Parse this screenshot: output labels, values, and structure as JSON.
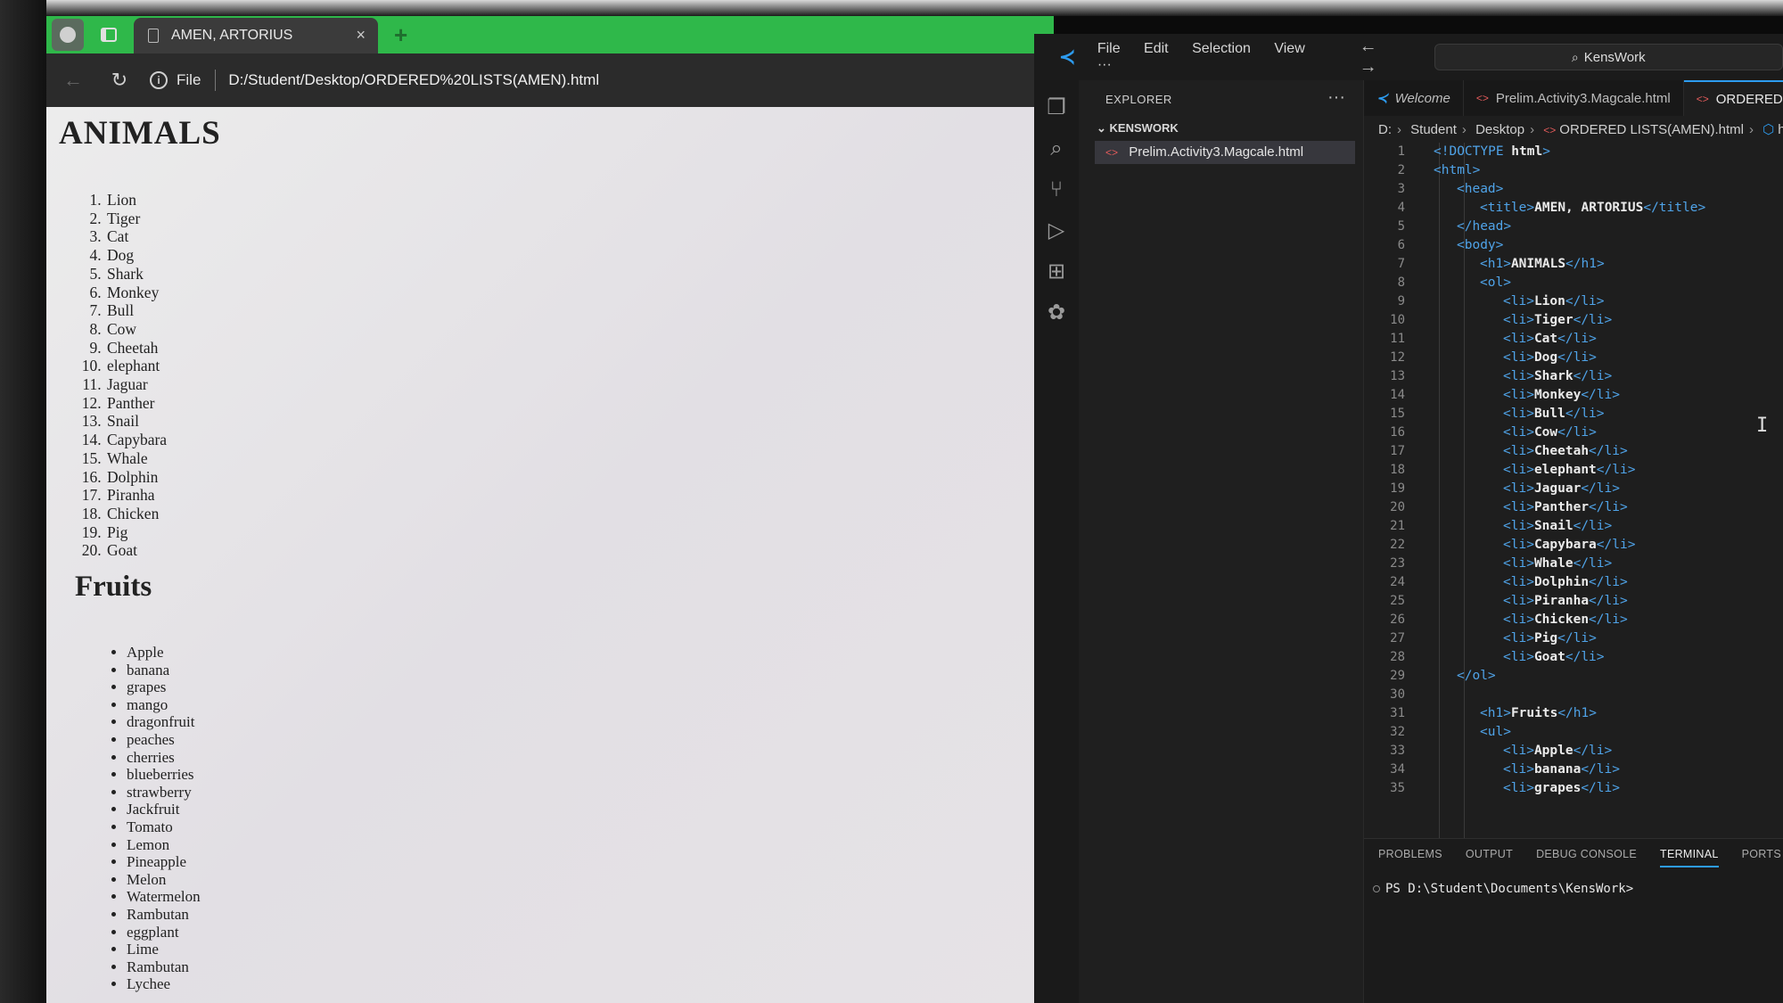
{
  "browser": {
    "tab_title": "AMEN, ARTORIUS",
    "tab_close": "×",
    "new_tab": "+",
    "back": "←",
    "reload": "↻",
    "info": "i",
    "file_label": "File",
    "url": "D:/Student/Desktop/ORDERED%20LISTS(AMEN).html"
  },
  "page": {
    "heading_animals": "ANIMALS",
    "animals": [
      "Lion",
      "Tiger",
      "Cat",
      "Dog",
      "Shark",
      "Monkey",
      "Bull",
      "Cow",
      "Cheetah",
      "elephant",
      "Jaguar",
      "Panther",
      "Snail",
      "Capybara",
      "Whale",
      "Dolphin",
      "Piranha",
      "Chicken",
      "Pig",
      "Goat"
    ],
    "heading_fruits": "Fruits",
    "fruits": [
      "Apple",
      "banana",
      "grapes",
      "mango",
      "dragonfruit",
      "peaches",
      "cherries",
      "blueberries",
      "strawberry",
      "Jackfruit",
      "Tomato",
      "Lemon",
      "Pineapple",
      "Melon",
      "Watermelon",
      "Rambutan",
      "eggplant",
      "Lime",
      "Rambutan",
      "Lychee"
    ]
  },
  "vscode": {
    "menu": [
      "File",
      "Edit",
      "Selection",
      "View",
      "···"
    ],
    "nav_back": "←",
    "nav_forward": "→",
    "search_text": "KensWork",
    "explorer_title": "EXPLORER",
    "explorer_more": "···",
    "folder": "KENSWORK",
    "file": "Prelim.Activity3.Magcale.html",
    "tabs": [
      {
        "label": "Welcome",
        "kind": "welcome"
      },
      {
        "label": "Prelim.Activity3.Magcale.html",
        "kind": "html"
      },
      {
        "label": "ORDERED",
        "kind": "html-active"
      }
    ],
    "breadcrumb": [
      "D:",
      "Student",
      "Desktop",
      "ORDERED LISTS(AMEN).html",
      "html"
    ],
    "code_lines": [
      "<!DOCTYPE html>",
      "<html>",
      "<head>",
      "<title>AMEN, ARTORIUS</title>",
      "</head>",
      "<body>",
      "<h1>ANIMALS</h1>",
      "<ol>",
      "<li>Lion</li>",
      "<li>Tiger</li>",
      "<li>Cat</li>",
      "<li>Dog</li>",
      "<li>Shark</li>",
      "<li>Monkey</li>",
      "<li>Bull</li>",
      "<li>Cow</li>",
      "<li>Cheetah</li>",
      "<li>elephant</li>",
      "<li>Jaguar</li>",
      "<li>Panther</li>",
      "<li>Snail</li>",
      "<li>Capybara</li>",
      "<li>Whale</li>",
      "<li>Dolphin</li>",
      "<li>Piranha</li>",
      "<li>Chicken</li>",
      "<li>Pig</li>",
      "<li>Goat</li>",
      "</ol>",
      "",
      "<h1>Fruits</h1>",
      "<ul>",
      "<li>Apple</li>",
      "<li>banana</li>",
      "<li>grapes</li>"
    ],
    "panel_tabs": [
      "PROBLEMS",
      "OUTPUT",
      "DEBUG CONSOLE",
      "TERMINAL",
      "PORTS"
    ],
    "active_panel_tab": "TERMINAL",
    "terminal_prompt": "PS D:\\Student\\Documents\\KensWork>"
  },
  "colors": {
    "browser_tab_strip": "#2fb84a",
    "vscode_accent": "#2d9cf0",
    "html_tag": "#4fa3e8",
    "file_icon": "#e05a5a"
  },
  "icons": {
    "activity_bar": [
      "files-icon",
      "search-icon",
      "source-control-icon",
      "run-debug-icon",
      "extensions-icon",
      "python-icon",
      "account-icon"
    ]
  }
}
